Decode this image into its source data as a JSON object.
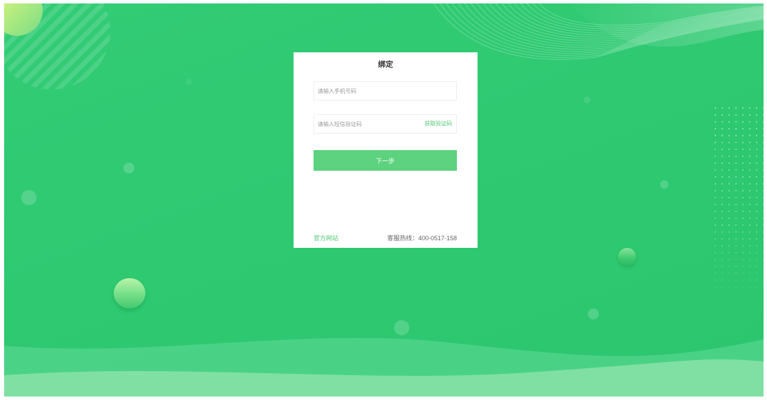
{
  "card": {
    "title": "绑定",
    "phone_placeholder": "请输入手机号码",
    "code_placeholder": "请输入短信验证码",
    "get_code_label": "获取验证码",
    "next_label": "下一步",
    "website_link": "官方网站",
    "hotline": "客服热线：400-0517-158"
  },
  "colors": {
    "background": "#2ec971",
    "accent": "#5dd27f",
    "link": "#4cc874",
    "card": "#ffffff"
  }
}
